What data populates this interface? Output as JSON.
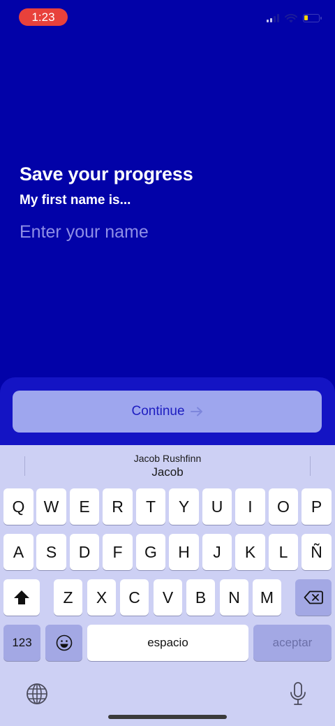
{
  "status_bar": {
    "time": "1:23"
  },
  "onboarding": {
    "title": "Save your progress",
    "subtitle": "My first name is...",
    "name_placeholder": "Enter your name",
    "name_value": "",
    "continue_label": "Continue"
  },
  "keyboard": {
    "suggestion_small": "Jacob Rushfinn",
    "suggestion_main": "Jacob",
    "row1": [
      "Q",
      "W",
      "E",
      "R",
      "T",
      "Y",
      "U",
      "I",
      "O",
      "P"
    ],
    "row2": [
      "A",
      "S",
      "D",
      "F",
      "G",
      "H",
      "J",
      "K",
      "L",
      "Ñ"
    ],
    "row3": [
      "Z",
      "X",
      "C",
      "V",
      "B",
      "N",
      "M"
    ],
    "numbers_label": "123",
    "space_label": "espacio",
    "return_label": "aceptar"
  },
  "icons": [
    "signal-icon",
    "wifi-icon",
    "battery-icon",
    "arrow-right-icon",
    "shift-icon",
    "delete-icon",
    "emoji-icon",
    "globe-icon",
    "microphone-icon"
  ],
  "colors": {
    "background": "#0202a8",
    "button": "#9ea6ee",
    "keyboard": "#cdd0f4",
    "time_pill": "#e8413b"
  }
}
